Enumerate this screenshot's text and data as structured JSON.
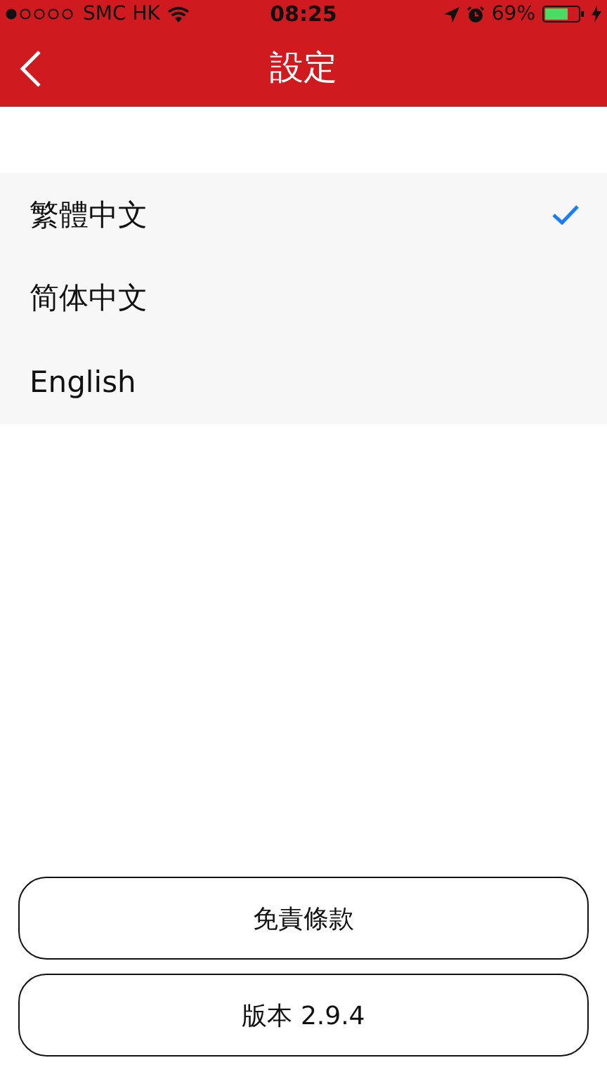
{
  "status_bar": {
    "carrier": "SMC HK",
    "time": "08:25",
    "battery": "69%"
  },
  "nav": {
    "title": "設定"
  },
  "languages": [
    {
      "label": "繁體中文",
      "selected": true
    },
    {
      "label": "简体中文",
      "selected": false
    },
    {
      "label": "English",
      "selected": false
    }
  ],
  "buttons": [
    "免責條款",
    "版本 2.9.4"
  ]
}
